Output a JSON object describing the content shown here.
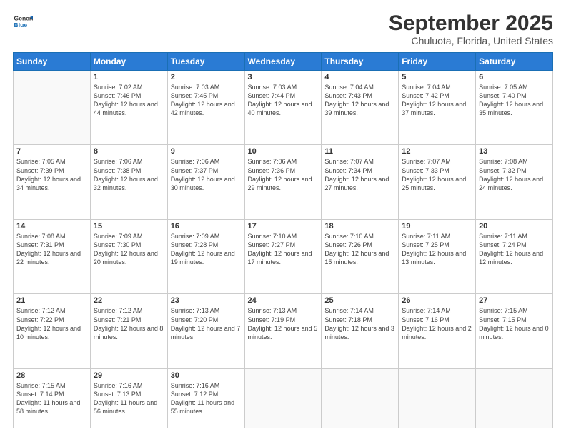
{
  "logo": {
    "line1": "General",
    "line2": "Blue"
  },
  "title": "September 2025",
  "location": "Chuluota, Florida, United States",
  "weekdays": [
    "Sunday",
    "Monday",
    "Tuesday",
    "Wednesday",
    "Thursday",
    "Friday",
    "Saturday"
  ],
  "weeks": [
    [
      null,
      {
        "day": 1,
        "sunrise": "7:02 AM",
        "sunset": "7:46 PM",
        "daylight": "12 hours and 44 minutes."
      },
      {
        "day": 2,
        "sunrise": "7:03 AM",
        "sunset": "7:45 PM",
        "daylight": "12 hours and 42 minutes."
      },
      {
        "day": 3,
        "sunrise": "7:03 AM",
        "sunset": "7:44 PM",
        "daylight": "12 hours and 40 minutes."
      },
      {
        "day": 4,
        "sunrise": "7:04 AM",
        "sunset": "7:43 PM",
        "daylight": "12 hours and 39 minutes."
      },
      {
        "day": 5,
        "sunrise": "7:04 AM",
        "sunset": "7:42 PM",
        "daylight": "12 hours and 37 minutes."
      },
      {
        "day": 6,
        "sunrise": "7:05 AM",
        "sunset": "7:40 PM",
        "daylight": "12 hours and 35 minutes."
      }
    ],
    [
      {
        "day": 7,
        "sunrise": "7:05 AM",
        "sunset": "7:39 PM",
        "daylight": "12 hours and 34 minutes."
      },
      {
        "day": 8,
        "sunrise": "7:06 AM",
        "sunset": "7:38 PM",
        "daylight": "12 hours and 32 minutes."
      },
      {
        "day": 9,
        "sunrise": "7:06 AM",
        "sunset": "7:37 PM",
        "daylight": "12 hours and 30 minutes."
      },
      {
        "day": 10,
        "sunrise": "7:06 AM",
        "sunset": "7:36 PM",
        "daylight": "12 hours and 29 minutes."
      },
      {
        "day": 11,
        "sunrise": "7:07 AM",
        "sunset": "7:34 PM",
        "daylight": "12 hours and 27 minutes."
      },
      {
        "day": 12,
        "sunrise": "7:07 AM",
        "sunset": "7:33 PM",
        "daylight": "12 hours and 25 minutes."
      },
      {
        "day": 13,
        "sunrise": "7:08 AM",
        "sunset": "7:32 PM",
        "daylight": "12 hours and 24 minutes."
      }
    ],
    [
      {
        "day": 14,
        "sunrise": "7:08 AM",
        "sunset": "7:31 PM",
        "daylight": "12 hours and 22 minutes."
      },
      {
        "day": 15,
        "sunrise": "7:09 AM",
        "sunset": "7:30 PM",
        "daylight": "12 hours and 20 minutes."
      },
      {
        "day": 16,
        "sunrise": "7:09 AM",
        "sunset": "7:28 PM",
        "daylight": "12 hours and 19 minutes."
      },
      {
        "day": 17,
        "sunrise": "7:10 AM",
        "sunset": "7:27 PM",
        "daylight": "12 hours and 17 minutes."
      },
      {
        "day": 18,
        "sunrise": "7:10 AM",
        "sunset": "7:26 PM",
        "daylight": "12 hours and 15 minutes."
      },
      {
        "day": 19,
        "sunrise": "7:11 AM",
        "sunset": "7:25 PM",
        "daylight": "12 hours and 13 minutes."
      },
      {
        "day": 20,
        "sunrise": "7:11 AM",
        "sunset": "7:24 PM",
        "daylight": "12 hours and 12 minutes."
      }
    ],
    [
      {
        "day": 21,
        "sunrise": "7:12 AM",
        "sunset": "7:22 PM",
        "daylight": "12 hours and 10 minutes."
      },
      {
        "day": 22,
        "sunrise": "7:12 AM",
        "sunset": "7:21 PM",
        "daylight": "12 hours and 8 minutes."
      },
      {
        "day": 23,
        "sunrise": "7:13 AM",
        "sunset": "7:20 PM",
        "daylight": "12 hours and 7 minutes."
      },
      {
        "day": 24,
        "sunrise": "7:13 AM",
        "sunset": "7:19 PM",
        "daylight": "12 hours and 5 minutes."
      },
      {
        "day": 25,
        "sunrise": "7:14 AM",
        "sunset": "7:18 PM",
        "daylight": "12 hours and 3 minutes."
      },
      {
        "day": 26,
        "sunrise": "7:14 AM",
        "sunset": "7:16 PM",
        "daylight": "12 hours and 2 minutes."
      },
      {
        "day": 27,
        "sunrise": "7:15 AM",
        "sunset": "7:15 PM",
        "daylight": "12 hours and 0 minutes."
      }
    ],
    [
      {
        "day": 28,
        "sunrise": "7:15 AM",
        "sunset": "7:14 PM",
        "daylight": "11 hours and 58 minutes."
      },
      {
        "day": 29,
        "sunrise": "7:16 AM",
        "sunset": "7:13 PM",
        "daylight": "11 hours and 56 minutes."
      },
      {
        "day": 30,
        "sunrise": "7:16 AM",
        "sunset": "7:12 PM",
        "daylight": "11 hours and 55 minutes."
      },
      null,
      null,
      null,
      null
    ]
  ],
  "labels": {
    "sunrise": "Sunrise:",
    "sunset": "Sunset:",
    "daylight": "Daylight:"
  }
}
